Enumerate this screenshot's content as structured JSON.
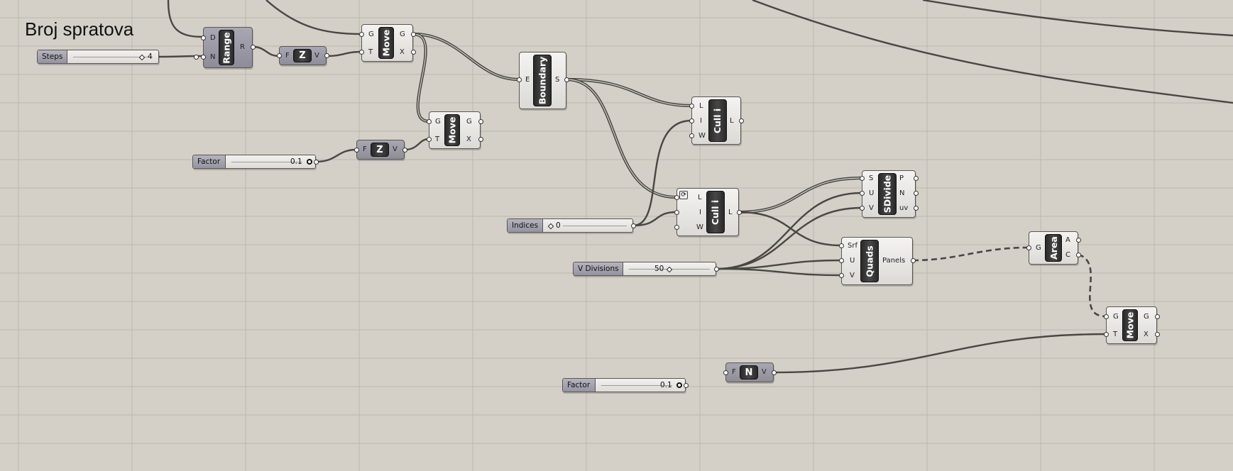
{
  "title": "Broj spratova",
  "sliders": {
    "steps": {
      "label": "Steps",
      "value": "4"
    },
    "factor1": {
      "label": "Factor",
      "value": "0.1"
    },
    "indices": {
      "label": "Indices",
      "value": "0"
    },
    "vdiv": {
      "label": "V Divisions",
      "value": "50"
    },
    "factor2": {
      "label": "Factor",
      "value": "0.1"
    }
  },
  "components": {
    "range": {
      "name": "Range",
      "inputs": [
        "D",
        "N"
      ],
      "outputs": [
        "R"
      ]
    },
    "unitz1": {
      "name": "Z",
      "inputs": [
        "F"
      ],
      "outputs": [
        "V"
      ]
    },
    "move1": {
      "name": "Move",
      "inputs": [
        "G",
        "T"
      ],
      "outputs": [
        "G",
        "X"
      ]
    },
    "unitz2": {
      "name": "Z",
      "inputs": [
        "F"
      ],
      "outputs": [
        "V"
      ]
    },
    "move2": {
      "name": "Move",
      "inputs": [
        "G",
        "T"
      ],
      "outputs": [
        "G",
        "X"
      ]
    },
    "boundary": {
      "name": "Boundary",
      "inputs": [
        "E"
      ],
      "outputs": [
        "S"
      ]
    },
    "cull1": {
      "name": "Cull i",
      "inputs": [
        "L",
        "I",
        "W"
      ],
      "outputs": [
        "L"
      ]
    },
    "cull2": {
      "name": "Cull i",
      "inputs": [
        "L",
        "I",
        "W"
      ],
      "outputs": [
        "L"
      ]
    },
    "sdivide": {
      "name": "SDivide",
      "inputs": [
        "S",
        "U",
        "V"
      ],
      "outputs": [
        "P",
        "N",
        "uv"
      ]
    },
    "quads": {
      "name": "Quads",
      "inputs": [
        "Srf",
        "U",
        "V"
      ],
      "outputs": [
        "Panels"
      ]
    },
    "area": {
      "name": "Area",
      "inputs": [
        "G"
      ],
      "outputs": [
        "A",
        "C"
      ]
    },
    "move3": {
      "name": "Move",
      "inputs": [
        "G",
        "T"
      ],
      "outputs": [
        "G",
        "X"
      ]
    },
    "unitz3": {
      "name": "N",
      "inputs": [
        "F"
      ],
      "outputs": [
        "V"
      ]
    }
  },
  "colors": {
    "canvas": "#d4d0c8",
    "grid": "#bcb8b0",
    "wire": "#4a4743"
  }
}
